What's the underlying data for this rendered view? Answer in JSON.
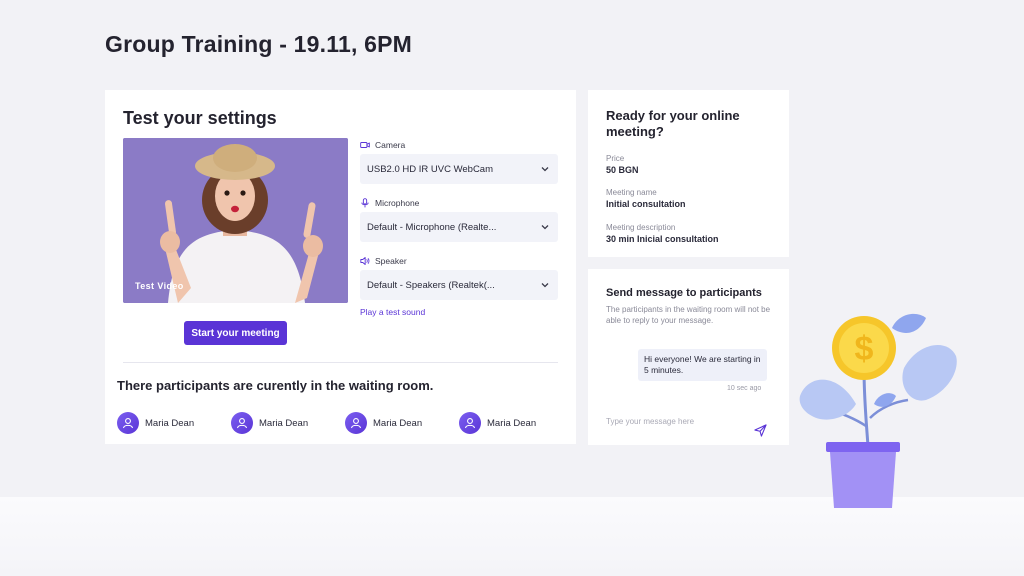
{
  "page": {
    "title": "Group Training - 19.11, 6PM"
  },
  "settings": {
    "title": "Test your settings",
    "video_label": "Test Video",
    "start_button": "Start your meeting",
    "camera": {
      "label": "Camera",
      "value": "USB2.0 HD IR UVC WebCam",
      "icon": "camera-icon"
    },
    "microphone": {
      "label": "Microphone",
      "value": "Default - Microphone (Realte...",
      "icon": "microphone-icon"
    },
    "speaker": {
      "label": "Speaker",
      "value": "Default - Speakers (Realtek(...",
      "icon": "speaker-icon"
    },
    "test_sound": "Play a test sound"
  },
  "waiting": {
    "title": "There participants are curently in the waiting room.",
    "participants": [
      "Maria Dean",
      "Maria Dean",
      "Maria Dean",
      "Maria Dean"
    ]
  },
  "meeting_info": {
    "title": "Ready for your online meeting?",
    "price_label": "Price",
    "price_value": "50 BGN",
    "name_label": "Meeting name",
    "name_value": "Initial consultation",
    "desc_label": "Meeting description",
    "desc_value": "30 min Inicial consultation"
  },
  "messages": {
    "title": "Send message to participants",
    "description": "The participants in the waiting room will not be able to reply to your message.",
    "sent_message": "Hi everyone! We are starting in 5 minutes.",
    "sent_time": "10 sec ago",
    "input_placeholder": "Type your message here"
  },
  "colors": {
    "accent": "#5a34d6",
    "background": "#f2f2f6",
    "card": "#ffffff"
  }
}
